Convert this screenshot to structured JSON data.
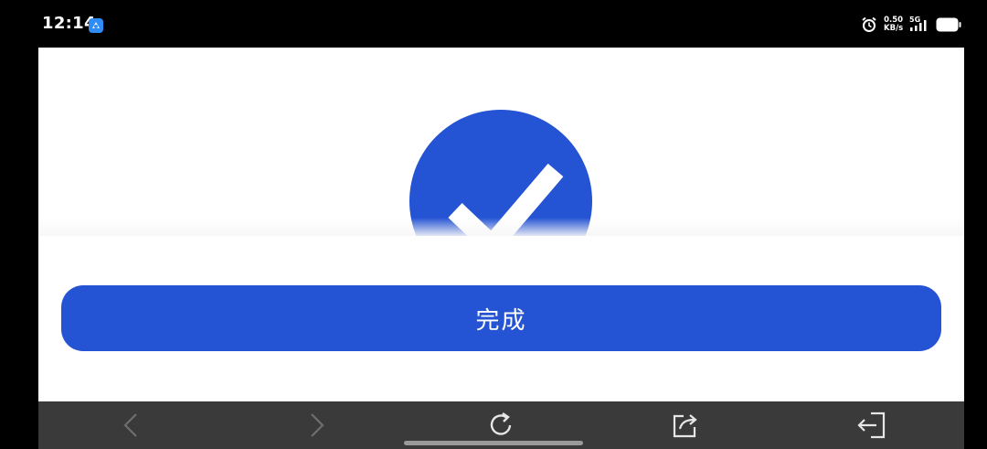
{
  "status_bar": {
    "time": "12:14",
    "net_speed_value": "0.50",
    "net_speed_unit": "KB/s",
    "network_type": "5G",
    "app_badge_color": "#2f8cf5"
  },
  "main": {
    "success_icon": "check-circle-icon",
    "accent_color": "#2453d4"
  },
  "sheet": {
    "done_label": "完成"
  },
  "bottom_nav": {
    "items": [
      {
        "icon": "back-arrow-icon",
        "enabled": false
      },
      {
        "icon": "forward-arrow-icon",
        "enabled": false
      },
      {
        "icon": "refresh-icon",
        "enabled": true
      },
      {
        "icon": "share-icon",
        "enabled": true
      },
      {
        "icon": "exit-icon",
        "enabled": true
      }
    ]
  }
}
